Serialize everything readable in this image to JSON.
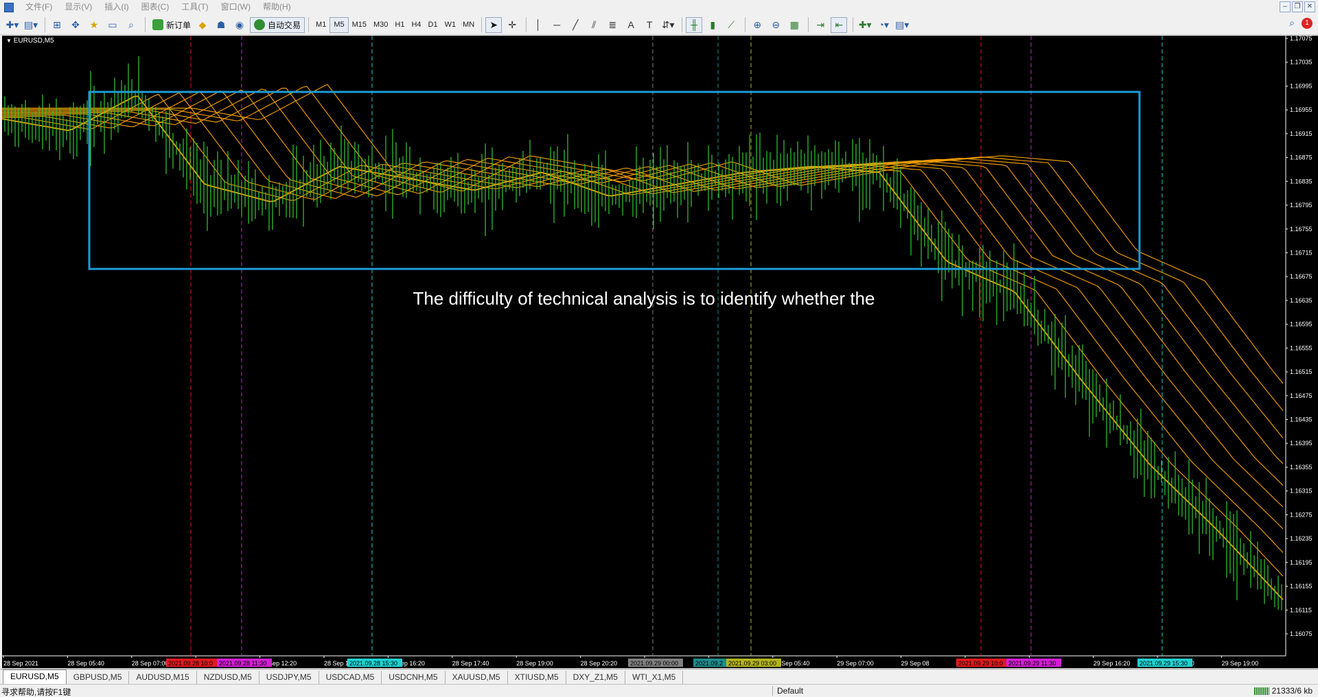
{
  "menubar": {
    "items": [
      "文件(F)",
      "显示(V)",
      "插入(I)",
      "图表(C)",
      "工具(T)",
      "窗口(W)",
      "帮助(H)"
    ]
  },
  "toolbar": {
    "new_order_label": "新订单",
    "auto_trading_label": "自动交易",
    "timeframes": [
      "M1",
      "M5",
      "M15",
      "M30",
      "H1",
      "H4",
      "D1",
      "W1",
      "MN"
    ],
    "active_timeframe": "M5",
    "alert_count": "1"
  },
  "chart": {
    "title": "EURUSD,M5",
    "caption": "The difficulty of technical analysis is to identify whether the",
    "colors": {
      "background": "#000000",
      "bull": "#32cd32",
      "ribbon": "#ffa500",
      "box": "#1e9bd7"
    },
    "price_labels": [
      "1.17075",
      "1.17035",
      "1.16995",
      "1.16955",
      "1.16915",
      "1.16875",
      "1.16835",
      "1.16795",
      "1.16755",
      "1.16715",
      "1.16675",
      "1.16635",
      "1.16595",
      "1.16555",
      "1.16515",
      "1.16475",
      "1.16435",
      "1.16395",
      "1.16355",
      "1.16315",
      "1.16275",
      "1.16235",
      "1.16195",
      "1.16155",
      "1.16115",
      "1.16075"
    ],
    "time_labels": [
      "28 Sep 2021",
      "28 Sep 05:40",
      "28 Sep 07:00",
      "28 Sep 08",
      "28 Sep 12:20",
      "28 Sep 13:",
      "28 Sep 16:20",
      "28 Sep 17:40",
      "28 Sep 19:00",
      "28 Sep 20:20",
      "28 Sep 21:40",
      "29 Sep 04:20",
      "29 Sep 05:40",
      "29 Sep 07:00",
      "29 Sep 08",
      "29 Sep 12:20",
      "29 Sep 13:",
      "29 Sep 16:20",
      "29 Sep 17:40",
      "29 Sep 19:00"
    ],
    "session_tags": [
      "2021.09.28 10:0",
      "2021.09.28 11:30",
      "2021.09.28 15:30",
      "2021.09.29 00:00",
      "2021.09.2",
      "2021.09.29 03:00",
      "2021.09.29 10:0",
      "2021.09.29 11:30",
      "2021.09.29 15:30"
    ],
    "session_tag_colors": [
      "#e0191e",
      "#d21ed2",
      "#1ed2d2",
      "#808080",
      "#1e8c8c",
      "#b4b41e",
      "#e0191e",
      "#d21ed2",
      "#1ed2d2"
    ]
  },
  "chart_data": {
    "type": "line",
    "title": "EURUSD,M5",
    "xlabel": "",
    "ylabel": "",
    "ylim": [
      1.16075,
      1.17075
    ],
    "x": [
      "28 Sep 2021",
      "28 Sep 05:40",
      "28 Sep 07:00",
      "28 Sep 08",
      "28 Sep 12:20",
      "28 Sep 13:",
      "28 Sep 16:20",
      "28 Sep 17:40",
      "28 Sep 19:00",
      "28 Sep 20:20",
      "28 Sep 21:40",
      "29 Sep 04:20",
      "29 Sep 05:40",
      "29 Sep 07:00",
      "29 Sep 08",
      "29 Sep 12:20",
      "29 Sep 13:",
      "29 Sep 16:20",
      "29 Sep 17:40",
      "29 Sep 19:00"
    ],
    "series": [
      {
        "values": [
          1.1694,
          1.1692,
          1.1698,
          1.1683,
          1.168,
          1.1686,
          1.1684,
          1.1682,
          1.1685,
          1.1681,
          1.1683,
          1.1685,
          1.1686,
          1.1685,
          1.167,
          1.1665,
          1.165,
          1.1636,
          1.1625,
          1.1613
        ]
      }
    ]
  },
  "tabs": [
    "EURUSD,M5",
    "GBPUSD,M5",
    "AUDUSD,M15",
    "NZDUSD,M5",
    "USDJPY,M5",
    "USDCAD,M5",
    "USDCNH,M5",
    "XAUUSD,M5",
    "XTIUSD,M5",
    "DXY_Z1,M5",
    "WTI_X1,M5"
  ],
  "statusbar": {
    "help_text": "寻求帮助,请按F1键",
    "profile": "Default",
    "traffic": "21333/6 kb"
  }
}
